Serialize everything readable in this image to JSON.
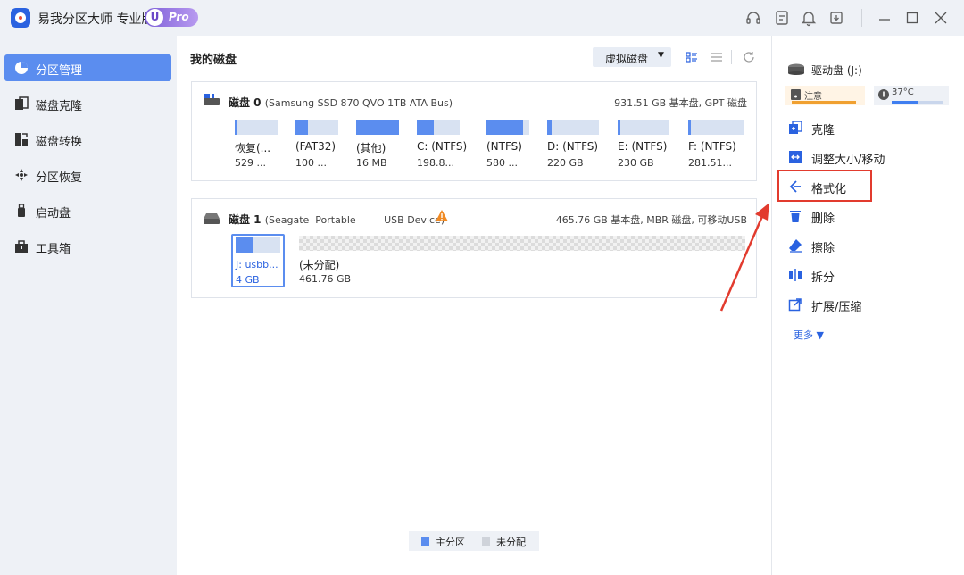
{
  "titlebar": {
    "app_title": "易我分区大师 专业版",
    "badge_letter": "U",
    "badge_text": "Pro",
    "icons": [
      "headset-icon",
      "feedback-icon",
      "bell-icon",
      "download-icon",
      "minimize-icon",
      "maximize-icon",
      "close-icon"
    ]
  },
  "sidebar": {
    "items": [
      {
        "label": "分区管理",
        "icon": "partition-pie-icon",
        "active": true
      },
      {
        "label": "磁盘克隆",
        "icon": "clone-icon",
        "active": false
      },
      {
        "label": "磁盘转换",
        "icon": "convert-icon",
        "active": false
      },
      {
        "label": "分区恢复",
        "icon": "recovery-icon",
        "active": false
      },
      {
        "label": "启动盘",
        "icon": "usb-icon",
        "active": false
      },
      {
        "label": "工具箱",
        "icon": "toolbox-icon",
        "active": false
      }
    ]
  },
  "main": {
    "title": "我的磁盘",
    "virtual_disk_label": "虚拟磁盘",
    "disks": [
      {
        "title": "磁盘 0",
        "model": "(Samsung SSD 870 QVO 1TB ATA Bus)",
        "info": "931.51 GB 基本盘, GPT 磁盘",
        "partitions": [
          {
            "name": "恢复(...",
            "size": "529 ...",
            "used": 0.05
          },
          {
            "name": "(FAT32)",
            "size": "100 ...",
            "used": 0.3
          },
          {
            "name": "(其他)",
            "size": "16 MB",
            "used": 1.0
          },
          {
            "name": "C: (NTFS)",
            "size": "198.8...",
            "used": 0.4
          },
          {
            "name": "(NTFS)",
            "size": "580 ...",
            "used": 0.85
          },
          {
            "name": "D: (NTFS)",
            "size": "220 GB",
            "used": 0.08
          },
          {
            "name": "E: (NTFS)",
            "size": "230 GB",
            "used": 0.05
          },
          {
            "name": "F: (NTFS)",
            "size": "281.51...",
            "used": 0.05
          }
        ]
      },
      {
        "title": "磁盘 1",
        "model": "(Seagate  Portable         USB Device)",
        "info": "465.76 GB 基本盘, MBR 磁盘, 可移动USB",
        "partitions": [
          {
            "name": "J: usbb...",
            "size": "4 GB",
            "used": 0.4,
            "selected": true
          },
          {
            "name": "(未分配)",
            "size": "461.76 GB",
            "unallocated": true
          }
        ]
      }
    ],
    "legend": [
      {
        "label": "主分区",
        "color": "#5b8def"
      },
      {
        "label": "未分配",
        "color": "#cfd3da"
      }
    ]
  },
  "right_panel": {
    "drive_name": "驱动盘  (J:)",
    "health_label": "注意",
    "temperature": "37°C",
    "temperature_level": 0.5,
    "actions": [
      {
        "label": "克隆",
        "icon": "clone-action-icon"
      },
      {
        "label": "调整大小/移动",
        "icon": "resize-icon"
      },
      {
        "label": "格式化",
        "icon": "format-icon",
        "highlighted": true
      },
      {
        "label": "删除",
        "icon": "trash-icon"
      },
      {
        "label": "擦除",
        "icon": "eraser-icon"
      },
      {
        "label": "拆分",
        "icon": "split-icon"
      },
      {
        "label": "扩展/压缩",
        "icon": "extend-icon"
      }
    ],
    "more_label": "更多"
  },
  "colors": {
    "accent": "#5b8def",
    "highlight_red": "#e23b2e",
    "warning_orange": "#f0a030"
  }
}
